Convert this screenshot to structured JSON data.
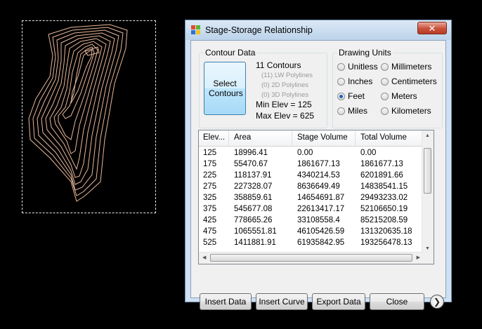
{
  "window": {
    "title": "Stage-Storage Relationship",
    "close_label": "✕"
  },
  "contour_group": {
    "title": "Contour Data",
    "select_button": "Select Contours",
    "count": "11 Contours",
    "lw": "(11) LW Polylines",
    "poly2d": "(0) 2D Polylines",
    "poly3d": "(0) 3D Polylines",
    "min_elev": "Min Elev = 125",
    "max_elev": "Max Elev = 625"
  },
  "units_group": {
    "title": "Drawing Units",
    "options": [
      {
        "label": "Unitless",
        "selected": false
      },
      {
        "label": "Inches",
        "selected": false
      },
      {
        "label": "Feet",
        "selected": true
      },
      {
        "label": "Miles",
        "selected": false
      },
      {
        "label": "Millimeters",
        "selected": false
      },
      {
        "label": "Centimeters",
        "selected": false
      },
      {
        "label": "Meters",
        "selected": false
      },
      {
        "label": "Kilometers",
        "selected": false
      }
    ]
  },
  "table": {
    "headers": [
      "Elev...",
      "Area",
      "Stage Volume",
      "Total Volume"
    ],
    "rows": [
      [
        "125",
        "18996.41",
        "0.00",
        "0.00"
      ],
      [
        "175",
        "55470.67",
        "1861677.13",
        "1861677.13"
      ],
      [
        "225",
        "118137.91",
        "4340214.53",
        "6201891.66"
      ],
      [
        "275",
        "227328.07",
        "8636649.49",
        "14838541.15"
      ],
      [
        "325",
        "358859.61",
        "14654691.87",
        "29493233.02"
      ],
      [
        "375",
        "545677.08",
        "22613417.17",
        "52106650.19"
      ],
      [
        "425",
        "778665.26",
        "33108558.4",
        "85215208.59"
      ],
      [
        "475",
        "1065551.81",
        "46105426.59",
        "131320635.18"
      ],
      [
        "525",
        "1411881.91",
        "61935842.95",
        "193256478.13"
      ]
    ]
  },
  "buttons": {
    "insert_data": "Insert Data",
    "insert_curve": "Insert Curve",
    "export_data": "Export Data",
    "close": "Close"
  },
  "colors": {
    "contour": "#e8b89a",
    "accent": "#1f62b8"
  }
}
